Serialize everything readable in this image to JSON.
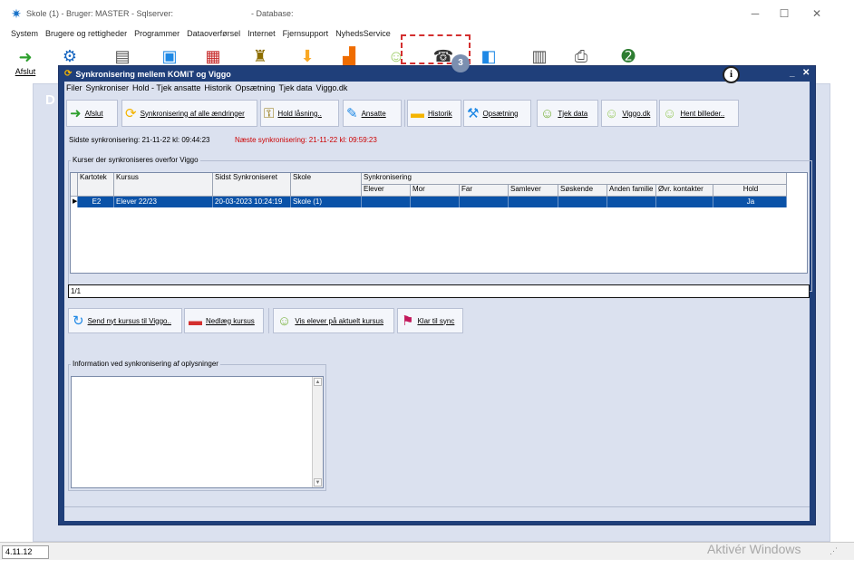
{
  "app": {
    "title": "Skole (1) - Bruger: MASTER - Sqlserver:",
    "title_db": "- Database:",
    "version": "4.11.12",
    "watermark": "Aktivér Windows"
  },
  "main_menu": [
    "System",
    "Brugere og rettigheder",
    "Programmer",
    "Dataoverførsel",
    "Internet",
    "Fjernsupport",
    "NyhedsService"
  ],
  "main_toolbar": {
    "afslut_label": "Afslut",
    "letter": "D"
  },
  "dialog": {
    "title": "Synkronisering mellem KOMiT og Viggo",
    "menu": [
      "Filer",
      "Synkroniser",
      "Hold - Tjek ansatte",
      "Historik",
      "Opsætning",
      "Tjek data",
      "Viggo.dk"
    ],
    "toolbar": {
      "afslut": "Afslut",
      "sync_all": "Synkronisering af alle ændringer",
      "hold_laasning": "Hold låsning..",
      "ansatte": "Ansatte",
      "historik": "Historik",
      "opsaetning": "Opsætning",
      "tjek_data": "Tjek data",
      "viggo_dk": "Viggo.dk",
      "hent_billeder": "Hent billeder.."
    },
    "callout_number": "3",
    "last_sync": "Sidste synkronisering: 21-11-22 kl: 09:44:23",
    "next_sync": "Næste synkronisering: 21-11-22 kl: 09:59:23",
    "courses_group_label": "Kurser der synkroniseres overfor Viggo",
    "grid": {
      "headers": {
        "kartotek": "Kartotek",
        "kursus": "Kursus",
        "sidst": "Sidst Synkroniseret",
        "skole": "Skole",
        "synk": "Synkronisering",
        "elever": "Elever",
        "mor": "Mor",
        "far": "Far",
        "samlever": "Samlever",
        "soeskende": "Søskende",
        "anden": "Anden familie",
        "ovr": "Øvr. kontakter",
        "hold": "Hold"
      },
      "row": {
        "kartotek": "E2",
        "kursus": "Elever 22/23",
        "sidst": "20-03-2023 10:24:19",
        "skole": "Skole (1)",
        "hold": "Ja"
      }
    },
    "navigator": "1/1",
    "buttons": {
      "send": "Send nyt kursus til Viggo..",
      "nedlaeg": "Nedlæg kursus",
      "vis_elever": "Vis elever på aktuelt kursus",
      "klar": "Klar til sync"
    },
    "info_group_label": "Information ved synkronisering af oplysninger"
  },
  "colors": {
    "dialog_frame": "#1f3f7a",
    "selection": "#0a52a8",
    "callout": "#d32f2f",
    "next_sync": "#cc0000"
  }
}
